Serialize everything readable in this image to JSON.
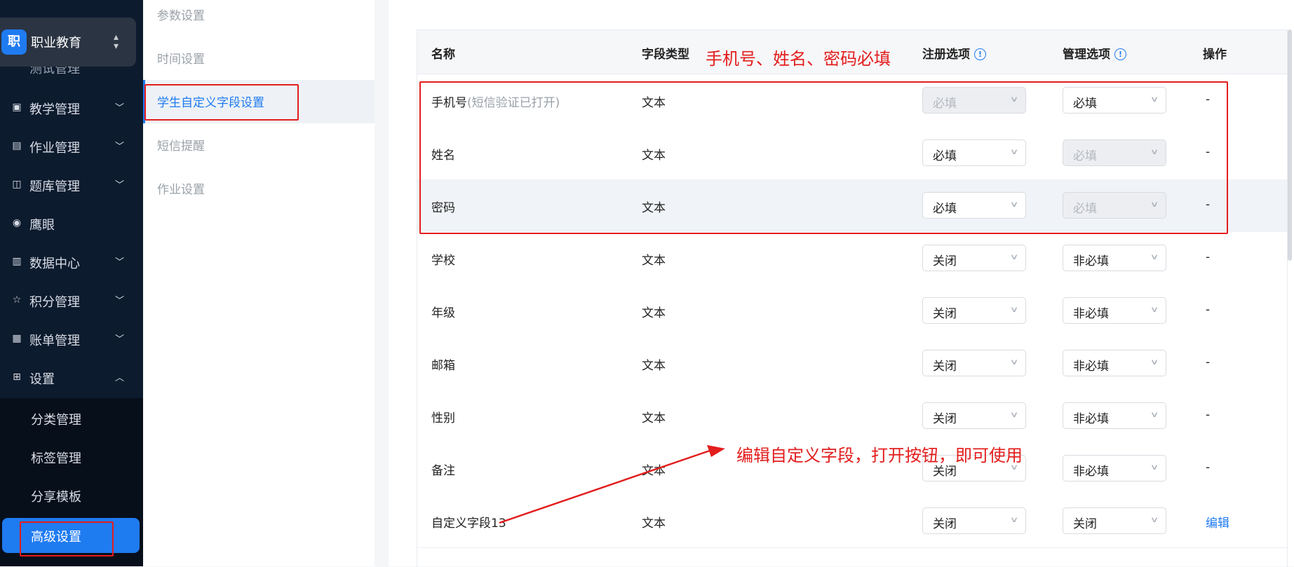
{
  "sidebar": {
    "brand": {
      "logo": "职",
      "name": "职业教育"
    },
    "partial_item": "测试管理",
    "items": [
      {
        "label": "教学管理",
        "icon": "book-icon"
      },
      {
        "label": "作业管理",
        "icon": "clipboard-icon"
      },
      {
        "label": "题库管理",
        "icon": "copy-icon"
      },
      {
        "label": "鹰眼",
        "icon": "eye-icon"
      },
      {
        "label": "数据中心",
        "icon": "chart-icon"
      },
      {
        "label": "积分管理",
        "icon": "star-icon"
      },
      {
        "label": "账单管理",
        "icon": "bill-icon"
      },
      {
        "label": "设置",
        "icon": "grid-icon"
      }
    ],
    "sub_items": [
      {
        "label": "分类管理"
      },
      {
        "label": "标签管理"
      },
      {
        "label": "分享模板"
      },
      {
        "label": "高级设置"
      }
    ]
  },
  "settings_menu": [
    {
      "label": "参数设置"
    },
    {
      "label": "时间设置"
    },
    {
      "label": "学生自定义字段设置"
    },
    {
      "label": "短信提醒"
    },
    {
      "label": "作业设置"
    }
  ],
  "table": {
    "headers": {
      "name": "名称",
      "type": "字段类型",
      "register": "注册选项",
      "manage": "管理选项",
      "action": "操作"
    },
    "rows": [
      {
        "name": "手机号",
        "hint": "(短信验证已打开)",
        "type": "文本",
        "register": "必填",
        "register_disabled": true,
        "manage": "必填",
        "manage_disabled": false,
        "action": "-"
      },
      {
        "name": "姓名",
        "hint": "",
        "type": "文本",
        "register": "必填",
        "register_disabled": false,
        "manage": "必填",
        "manage_disabled": true,
        "action": "-"
      },
      {
        "name": "密码",
        "hint": "",
        "type": "文本",
        "register": "必填",
        "register_disabled": false,
        "manage": "必填",
        "manage_disabled": true,
        "action": "-"
      },
      {
        "name": "学校",
        "hint": "",
        "type": "文本",
        "register": "关闭",
        "manage": "非必填",
        "action": "-"
      },
      {
        "name": "年级",
        "hint": "",
        "type": "文本",
        "register": "关闭",
        "manage": "非必填",
        "action": "-"
      },
      {
        "name": "邮箱",
        "hint": "",
        "type": "文本",
        "register": "关闭",
        "manage": "非必填",
        "action": "-"
      },
      {
        "name": "性别",
        "hint": "",
        "type": "文本",
        "register": "关闭",
        "manage": "非必填",
        "action": "-"
      },
      {
        "name": "备注",
        "hint": "",
        "type": "文本",
        "register": "关闭",
        "manage": "非必填",
        "action": "-"
      },
      {
        "name": "自定义字段13",
        "hint": "",
        "type": "文本",
        "register": "关闭",
        "manage": "关闭",
        "action": "编辑"
      }
    ]
  },
  "annotations": {
    "required_note": "手机号、姓名、密码必填",
    "edit_note": "编辑自定义字段，打开按钮，即可使用",
    "color": "#e31d1d"
  },
  "colors": {
    "accent": "#1f7bf0",
    "sidebar_bg": "#0d1b2e"
  }
}
